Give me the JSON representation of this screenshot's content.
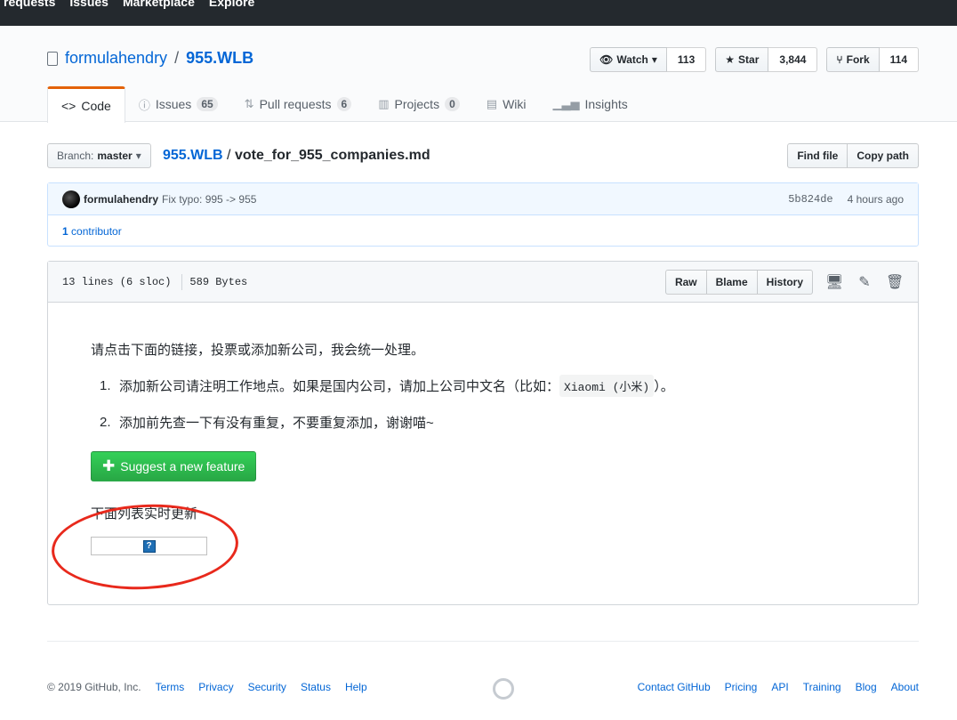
{
  "topnav": {
    "links": [
      "requests",
      "Issues",
      "Marketplace",
      "Explore"
    ]
  },
  "repo": {
    "owner": "formulahendry",
    "separator": "/",
    "name": "955.WLB",
    "watch_label": "Watch",
    "watch_count": "113",
    "star_label": "Star",
    "star_count": "3,844",
    "fork_label": "Fork",
    "fork_count": "114"
  },
  "tabs": [
    {
      "label": "Code",
      "icon": "code-icon"
    },
    {
      "label": "Issues",
      "count": "65",
      "icon": "issue-icon"
    },
    {
      "label": "Pull requests",
      "count": "6",
      "icon": "pr-icon"
    },
    {
      "label": "Projects",
      "count": "0",
      "icon": "project-icon"
    },
    {
      "label": "Wiki",
      "icon": "book-icon"
    },
    {
      "label": "Insights",
      "icon": "graph-icon"
    }
  ],
  "filenav": {
    "branch_prefix": "Branch:",
    "branch": "master",
    "root": "955.WLB",
    "separator": "/",
    "filename": "vote_for_955_companies.md",
    "find_file": "Find file",
    "copy_path": "Copy path"
  },
  "commit": {
    "author": "formulahendry",
    "message": "Fix typo: 995 -> 955",
    "sha": "5b824de",
    "time": "4 hours ago",
    "contributors_count": "1",
    "contributors_label": "contributor"
  },
  "file": {
    "lines": "13 lines (6 sloc)",
    "size": "589 Bytes",
    "raw": "Raw",
    "blame": "Blame",
    "history": "History"
  },
  "content": {
    "intro": "请点击下面的链接，投票或添加新公司，我会统一处理。",
    "item1_num": "1.",
    "item1_pre": "添加新公司请注明工作地点。如果是国内公司，请加上公司中文名（比如：",
    "item1_code": "Xiaomi (小米)",
    "item1_post": "）。",
    "item2_num": "2.",
    "item2": "添加前先查一下有没有重复，不要重复添加，谢谢喵~",
    "suggest_button": "Suggest a new feature",
    "list_note": "下面列表实时更新",
    "broken_glyph": "?"
  },
  "footer": {
    "copyright": "© 2019 GitHub, Inc.",
    "left_links": [
      "Terms",
      "Privacy",
      "Security",
      "Status",
      "Help"
    ],
    "right_links": [
      "Contact GitHub",
      "Pricing",
      "API",
      "Training",
      "Blog",
      "About"
    ]
  },
  "colors": {
    "annotation": "#e8291c",
    "accent_tab": "#e36209",
    "link": "#0366d6",
    "green_button": "#28a745"
  }
}
